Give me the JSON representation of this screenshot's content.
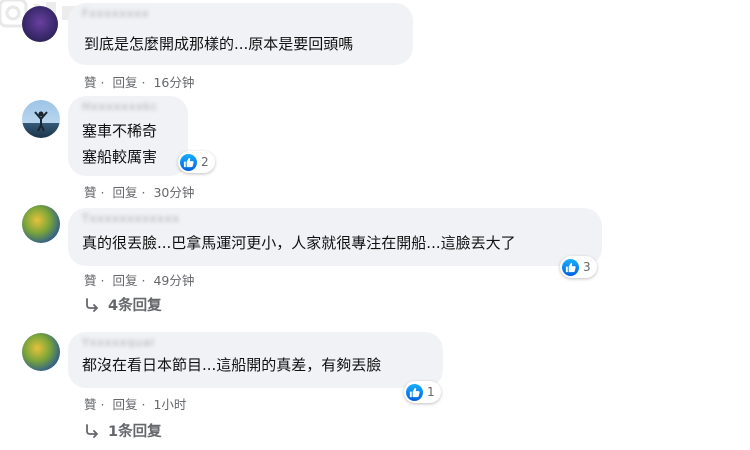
{
  "colors": {
    "bubble": "#f0f2f5",
    "meta_text": "#65676b",
    "like_blue": "#1877f2"
  },
  "comments": [
    {
      "author": "Fxxxxxxxx",
      "text_lines": [
        "到底是怎麼開成那樣的...原本是要回頭嗎"
      ],
      "like_label": "贊",
      "reply_label": "回复",
      "time": "16分钟"
    },
    {
      "author": "Hxxxxxxxkc",
      "text_lines": [
        "塞車不稀奇",
        "塞船較厲害"
      ],
      "reaction_count": "2",
      "like_label": "贊",
      "reply_label": "回复",
      "time": "30分钟"
    },
    {
      "author": "Txxxxxxxxxxxx",
      "text_lines": [
        "真的很丟臉...巴拿馬運河更小，人家就很專注在開船...這臉丟大了"
      ],
      "reaction_count": "3",
      "like_label": "贊",
      "reply_label": "回复",
      "time": "49分钟",
      "replies_label": "4条回复"
    },
    {
      "author": "Yxxxxxqual",
      "text_lines": [
        "都沒在看日本節目...這船開的真差，有夠丟臉"
      ],
      "reaction_count": "1",
      "like_label": "贊",
      "reply_label": "回复",
      "time": "1小时",
      "replies_label": "1条回复"
    }
  ]
}
